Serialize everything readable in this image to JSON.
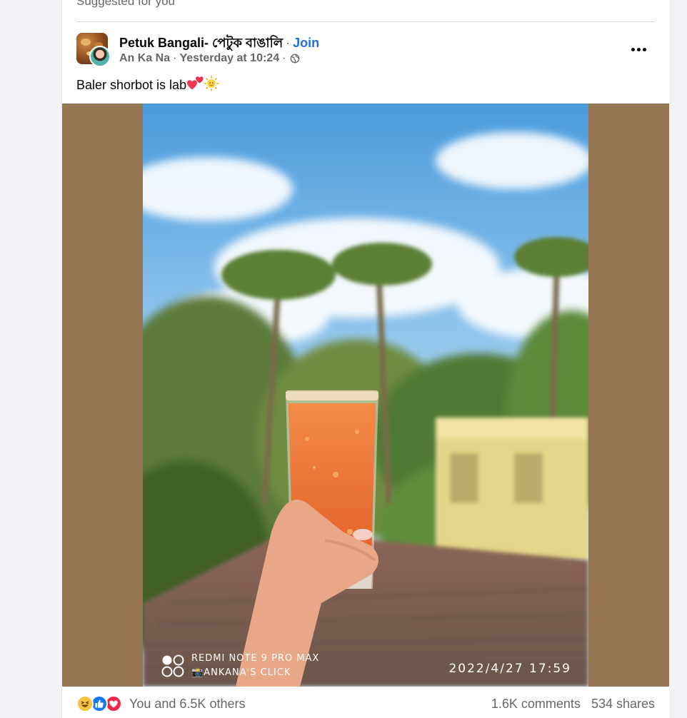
{
  "feed": {
    "section_label": "Suggested for you"
  },
  "post": {
    "group_name": "Petuk Bangali- পেটুক বাঙালি",
    "separator": "·",
    "join_label": "Join",
    "author": "An Ka Na",
    "timestamp": "Yesterday at 10:24",
    "privacy_icon": "globe-icon",
    "menu_icon": "more-horizontal-icon",
    "text": "Baler shorbot is lab",
    "text_emojis": [
      "two-hearts-emoji",
      "sun-emoji"
    ],
    "photo": {
      "watermark_device": "REDMI NOTE 9 PRO MAX",
      "watermark_credit": "📸ANKANA'S CLICK",
      "watermark_datetime": "2022/4/27 17:59"
    },
    "reactions": {
      "icons": [
        "haha-reaction-icon",
        "like-reaction-icon",
        "love-reaction-icon"
      ],
      "summary": "You and 6.5K others"
    },
    "comments": "1.6K comments",
    "shares": "534 shares"
  },
  "colors": {
    "link_blue": "#216fdb",
    "text_primary": "#050505",
    "text_secondary": "#65676b",
    "photo_frame": "#977654"
  }
}
